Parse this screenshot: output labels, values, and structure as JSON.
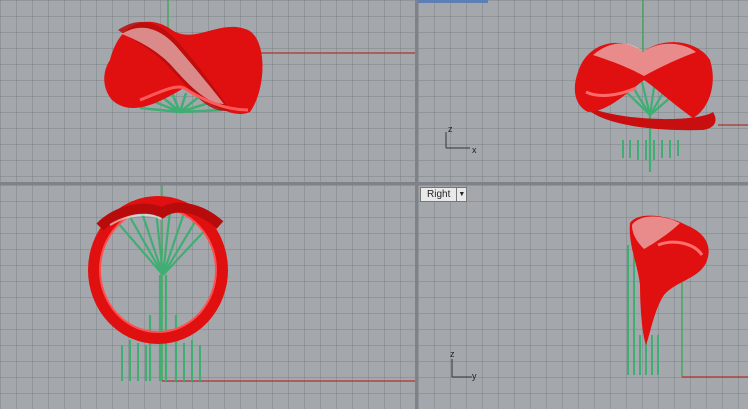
{
  "viewports": {
    "bottom_right": {
      "name": "Right",
      "axis_up": "z",
      "axis_right": "y"
    },
    "top_right": {
      "axis_up": "z",
      "axis_right": "x"
    }
  },
  "colors": {
    "viewport_bg": "#a4a8ad",
    "ring_red": "#e01010",
    "support_green": "#3fae72",
    "axis_red": "#b03030",
    "axis_green": "#2ea84a"
  },
  "icons": {
    "viewport_menu": "chevron-down-icon"
  }
}
